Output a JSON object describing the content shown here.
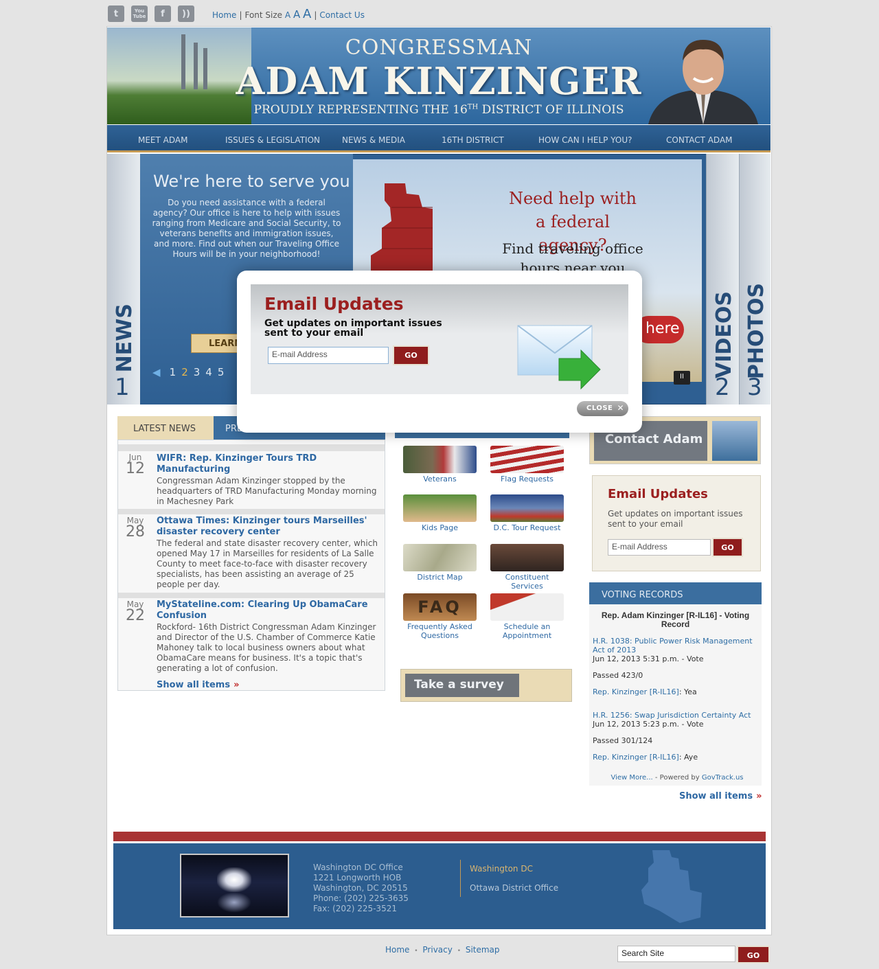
{
  "topbar": {
    "social": [
      {
        "name": "twitter-icon",
        "glyph": "t"
      },
      {
        "name": "youtube-icon",
        "glyph": "You Tube"
      },
      {
        "name": "facebook-icon",
        "glyph": "f"
      },
      {
        "name": "rss-icon",
        "glyph": "))"
      }
    ],
    "home": "Home",
    "font_size_label": "Font Size",
    "font_small": "A",
    "font_medium": "A",
    "font_large": "A",
    "contact": "Contact Us"
  },
  "banner": {
    "congressman": "CONGRESSMAN",
    "name": "ADAM KINZINGER",
    "tagline_before": "PROUDLY REPRESENTING THE 16",
    "tagline_sup": "TH",
    "tagline_after": " DISTRICT OF ILLINOIS"
  },
  "nav": [
    "MEET ADAM",
    "ISSUES & LEGISLATION",
    "NEWS & MEDIA",
    "16TH DISTRICT",
    "HOW CAN I HELP YOU?",
    "CONTACT ADAM"
  ],
  "slider": {
    "tab_news": "NEWS",
    "tab_news_num": "1",
    "tab_videos": "VIDEOS",
    "tab_videos_num": "2",
    "tab_photos": "PHOTOS",
    "tab_photos_num": "3",
    "heading": "We're here to serve you",
    "body": "Do you need assistance with a federal agency? Our office is here to help with issues ranging from Medicare and Social Security, to veterans benefits and immigration issues, and more. Find out when our Traveling Office Hours will be in your neighborhood!",
    "learn": "LEARN",
    "img_headline": "Need help with a federal agency?",
    "img_sub": "Find traveling office hours near you",
    "img_click": "here",
    "pages": [
      "1",
      "2",
      "3",
      "4",
      "5"
    ],
    "active_page": "2",
    "pause": "II"
  },
  "news": {
    "tab_latest": "LATEST NEWS",
    "tab_press": "PRE",
    "items": [
      {
        "month": "Jun",
        "day": "12",
        "title": "WIFR: Rep. Kinzinger Tours TRD Manufacturing",
        "body": "Congressman Adam Kinzinger stopped by the headquarters of TRD Manufacturing Monday morning in Machesney Park"
      },
      {
        "month": "May",
        "day": "28",
        "title": "Ottawa Times: Kinzinger tours Marseilles' disaster recovery center",
        "body": "The federal and state disaster recovery center, which opened May 17 in Marseilles for residents of La Salle County to meet face-to-face with disaster recovery specialists, has been assisting an average of 25 people per day."
      },
      {
        "month": "May",
        "day": "22",
        "title": "MyStateline.com: Clearing Up ObamaCare Confusion",
        "body": "Rockford- 16th District Congressman Adam Kinzinger and Director of the U.S. Chamber of Commerce Katie Mahoney talk to local business owners about what ObamaCare means for business. It's a topic that's generating a lot of confusion."
      }
    ],
    "show_all": "Show all items",
    "raquo": "»"
  },
  "quick_links": [
    {
      "label": "Veterans"
    },
    {
      "label": "Flag Requests"
    },
    {
      "label": "Kids Page"
    },
    {
      "label": "D.C. Tour Request"
    },
    {
      "label": "District Map"
    },
    {
      "label": "Constituent Services"
    },
    {
      "label": "Frequently Asked Questions"
    },
    {
      "label": "Schedule an Appointment"
    }
  ],
  "survey": "Take a survey",
  "contact_adam": "Contact Adam",
  "email_side": {
    "title": "Email Updates",
    "body": "Get updates on important issues sent to your email",
    "placeholder": "E-mail Address",
    "go": "GO"
  },
  "voting": {
    "header": "VOTING RECORDS",
    "record_title": "Rep. Adam Kinzinger [R-IL16] - Voting Record",
    "bills": [
      {
        "title": "H.R. 1038: Public Power Risk Management Act of 2013",
        "date": "Jun 12, 2013 5:31 p.m. - Vote",
        "passed": "Passed 423/0",
        "rep": "Rep. Kinzinger [R-IL16]",
        "vote": ": Yea"
      },
      {
        "title": "H.R. 1256: Swap Jurisdiction Certainty Act",
        "date": "Jun 12, 2013 5:23 p.m. - Vote",
        "passed": "Passed 301/124",
        "rep": "Rep. Kinzinger [R-IL16]",
        "vote": ": Aye"
      }
    ],
    "view_more": "View More...",
    "powered": " - Powered by ",
    "govtrack": "GovTrack.us",
    "show_all": "Show all items"
  },
  "footer": {
    "dc_office": [
      "Washington DC Office",
      "1221 Longworth HOB",
      "Washington, DC 20515",
      "Phone: (202) 225-3635",
      "Fax: (202) 225-3521"
    ],
    "office_dc": "Washington DC",
    "office_ottawa": "Ottawa District Office"
  },
  "bottom": {
    "home": "Home",
    "privacy": "Privacy",
    "sitemap": "Sitemap",
    "dot": "•",
    "search_placeholder": "Search Site",
    "go": "GO"
  },
  "modal": {
    "title": "Email Updates",
    "body": "Get updates on important issues sent to your email",
    "placeholder": "E-mail Address",
    "go": "GO",
    "close": "CLOSE",
    "close_x": "✕"
  },
  "colors": {
    "brand_blue": "#2c5d8f",
    "brand_red": "#8f1d1d",
    "accent_tan": "#eadbb5"
  }
}
